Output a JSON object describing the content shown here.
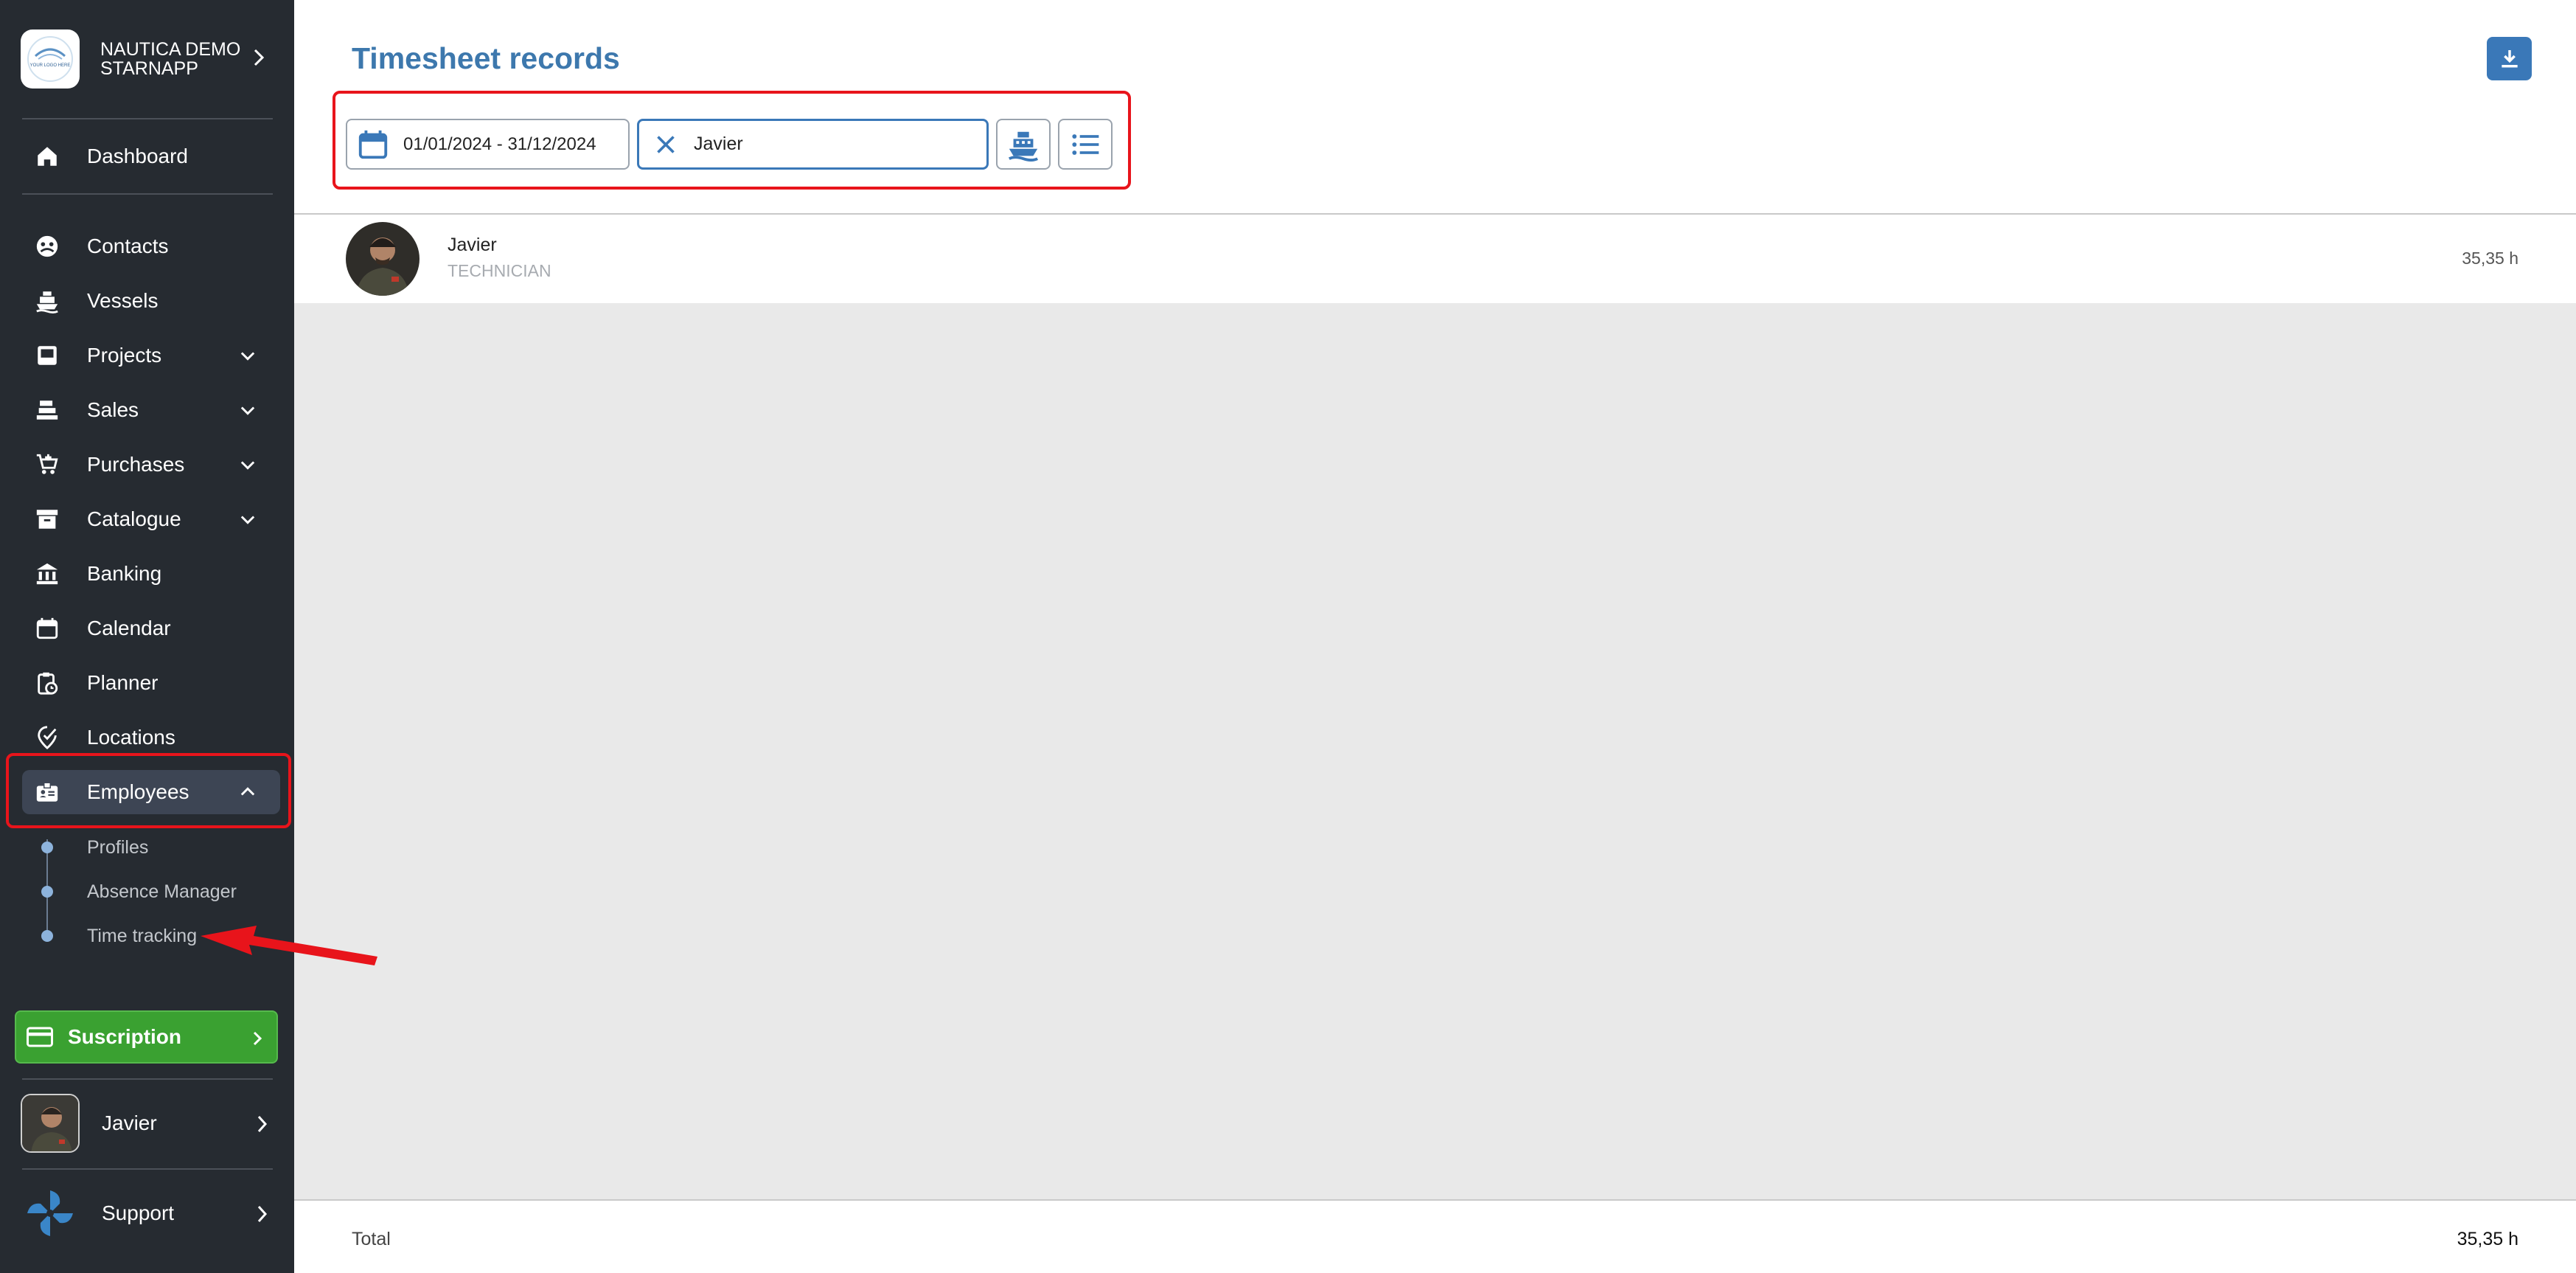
{
  "org": {
    "name": "NAUTICA DEMO STARNAPP",
    "logo_text": "YOUR LOGO HERE"
  },
  "sidebar": {
    "dashboard": "Dashboard",
    "items": [
      {
        "label": "Contacts",
        "icon": "contacts-icon"
      },
      {
        "label": "Vessels",
        "icon": "ship-icon"
      },
      {
        "label": "Projects",
        "icon": "inbox-icon",
        "expandable": true
      },
      {
        "label": "Sales",
        "icon": "cash-register-icon",
        "expandable": true
      },
      {
        "label": "Purchases",
        "icon": "cart-add-icon",
        "expandable": true
      },
      {
        "label": "Catalogue",
        "icon": "archive-icon",
        "expandable": true
      },
      {
        "label": "Banking",
        "icon": "bank-icon"
      },
      {
        "label": "Calendar",
        "icon": "calendar-icon"
      },
      {
        "label": "Planner",
        "icon": "clipboard-clock-icon"
      },
      {
        "label": "Locations",
        "icon": "location-check-icon"
      },
      {
        "label": "Employees",
        "icon": "badge-icon",
        "expandable": true,
        "expanded": true
      }
    ],
    "sub_items": [
      "Profiles",
      "Absence Manager",
      "Time tracking"
    ],
    "subscription": "Suscription",
    "user": "Javier",
    "support": "Support"
  },
  "main": {
    "title": "Timesheet records",
    "filters": {
      "date_range": "01/01/2024 - 31/12/2024",
      "employee": "Javier"
    },
    "records": [
      {
        "name": "Javier",
        "role": "TECHNICIAN",
        "hours": "35,35 h"
      }
    ],
    "footer": {
      "total_label": "Total",
      "total_value": "35,35 h"
    }
  },
  "colors": {
    "sidebar_bg": "#262b31",
    "accent": "#3a78b8",
    "title": "#3d78ad",
    "subscription": "#3aa131",
    "highlight": "#e8141b"
  }
}
